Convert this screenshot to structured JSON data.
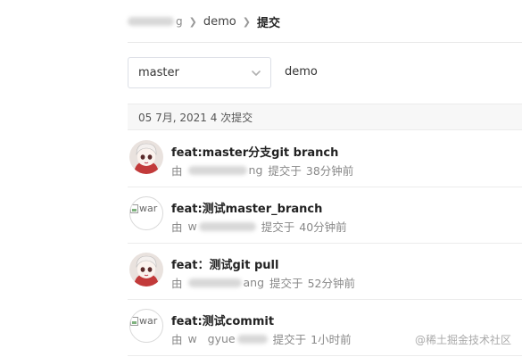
{
  "breadcrumb": {
    "owner_tail": "g",
    "repo": "demo",
    "current": "提交"
  },
  "branch_select": {
    "value": "master"
  },
  "repo_name": "demo",
  "group": {
    "date_label": "05 7月, 2021 4 次提交"
  },
  "commits": [
    {
      "title": "feat:master分支git branch",
      "by": "由",
      "author_tail": "ng",
      "action": "提交于",
      "time": "38分钟前",
      "avatar": "anime-avatar"
    },
    {
      "title": "feat:测试master_branch",
      "by": "由",
      "author_tail": "w",
      "action": "提交于",
      "time": "40分钟前",
      "avatar_alt": "war"
    },
    {
      "title": "feat：测试git pull",
      "by": "由",
      "author_tail": "ang",
      "action": "提交于",
      "time": "52分钟前",
      "avatar": "anime-avatar"
    },
    {
      "title": "feat:测试commit",
      "by": "由",
      "author_tail": "w   gyue",
      "action": "提交于",
      "time": "1小时前",
      "avatar_alt": "war"
    }
  ],
  "watermark": "@稀土掘金技术社区"
}
